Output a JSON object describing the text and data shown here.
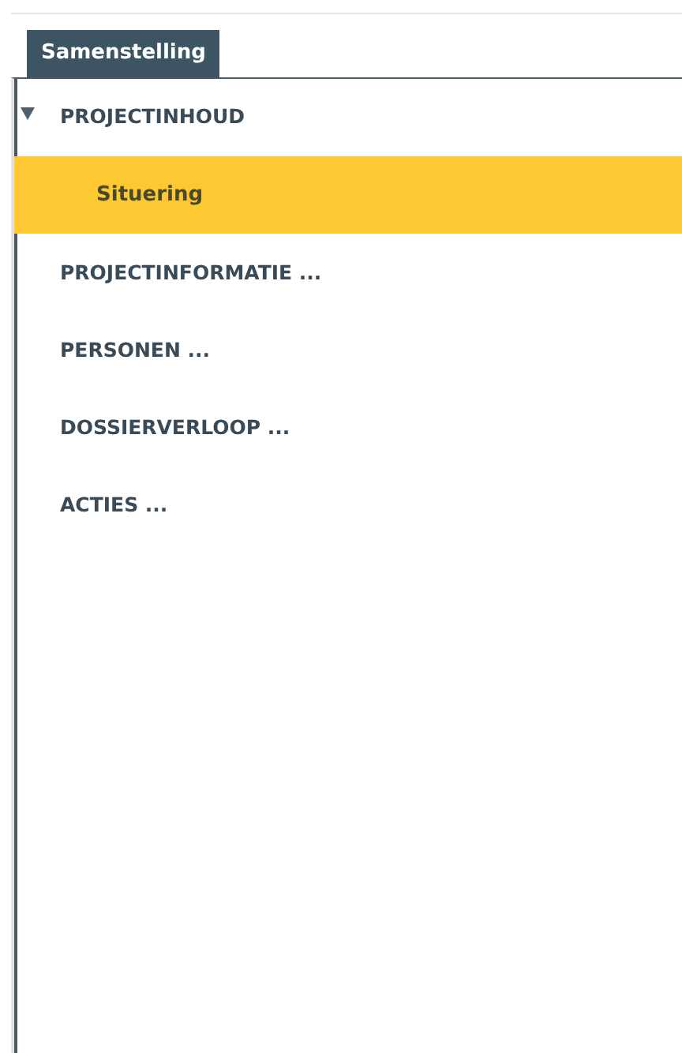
{
  "tab": {
    "label": "Samenstelling",
    "selected": true
  },
  "tree": [
    {
      "label": "PROJECTINHOUD",
      "selected": false,
      "expanded": true,
      "children": [
        {
          "label": "Situering",
          "selected": true
        }
      ]
    },
    {
      "label": "PROJECTINFORMATIE ...",
      "selected": false
    },
    {
      "label": "PERSONEN ...",
      "selected": false
    },
    {
      "label": "DOSSIERVERLOOP ...",
      "selected": false
    },
    {
      "label": "ACTIES ...",
      "selected": false
    }
  ]
}
